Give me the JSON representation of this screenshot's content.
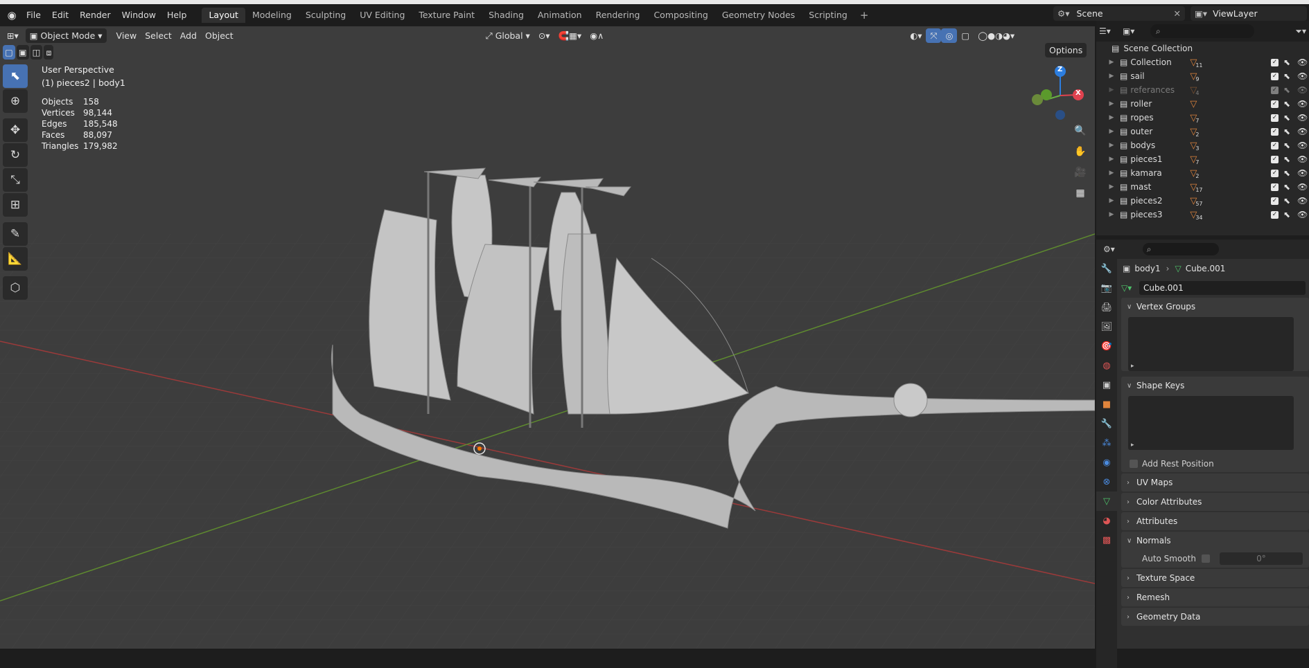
{
  "menubar": {
    "items": [
      "File",
      "Edit",
      "Render",
      "Window",
      "Help"
    ]
  },
  "workspaces": {
    "tabs": [
      "Layout",
      "Modeling",
      "Sculpting",
      "UV Editing",
      "Texture Paint",
      "Shading",
      "Animation",
      "Rendering",
      "Compositing",
      "Geometry Nodes",
      "Scripting"
    ],
    "active": "Layout"
  },
  "scene": {
    "name": "Scene",
    "view_layer": "ViewLayer"
  },
  "viewport_header": {
    "mode": "Object Mode",
    "menus": [
      "View",
      "Select",
      "Add",
      "Object"
    ],
    "orientation": "Global",
    "options": "Options"
  },
  "overlay": {
    "perspective": "User Perspective",
    "context": "(1) pieces2 | body1",
    "stats": [
      {
        "label": "Objects",
        "value": "158"
      },
      {
        "label": "Vertices",
        "value": "98,144"
      },
      {
        "label": "Edges",
        "value": "185,548"
      },
      {
        "label": "Faces",
        "value": "88,097"
      },
      {
        "label": "Triangles",
        "value": "179,982"
      }
    ]
  },
  "gizmo": {
    "z": "Z",
    "x": "X"
  },
  "outliner": {
    "root": "Scene Collection",
    "rows": [
      {
        "name": "Collection",
        "count": "11",
        "dim": false
      },
      {
        "name": "sail",
        "count": "9",
        "dim": false
      },
      {
        "name": "referances",
        "count": "4",
        "dim": true
      },
      {
        "name": "roller",
        "count": "",
        "dim": false
      },
      {
        "name": "ropes",
        "count": "7",
        "dim": false
      },
      {
        "name": "outer",
        "count": "2",
        "dim": false
      },
      {
        "name": "bodys",
        "count": "3",
        "dim": false
      },
      {
        "name": "pieces1",
        "count": "7",
        "dim": false
      },
      {
        "name": "kamara",
        "count": "2",
        "dim": false
      },
      {
        "name": "mast",
        "count": "17",
        "dim": false
      },
      {
        "name": "pieces2",
        "count": "57",
        "dim": false
      },
      {
        "name": "pieces3",
        "count": "34",
        "dim": false
      }
    ]
  },
  "properties": {
    "breadcrumb_object": "body1",
    "breadcrumb_mesh": "Cube.001",
    "mesh_name": "Cube.001",
    "panels": {
      "vertex_groups": "Vertex Groups",
      "shape_keys": "Shape Keys",
      "add_rest_position": "Add Rest Position",
      "uv_maps": "UV Maps",
      "color_attributes": "Color Attributes",
      "attributes": "Attributes",
      "normals": "Normals",
      "auto_smooth": "Auto Smooth",
      "auto_smooth_angle": "0°",
      "texture_space": "Texture Space",
      "remesh": "Remesh",
      "geometry_data": "Geometry Data"
    }
  }
}
